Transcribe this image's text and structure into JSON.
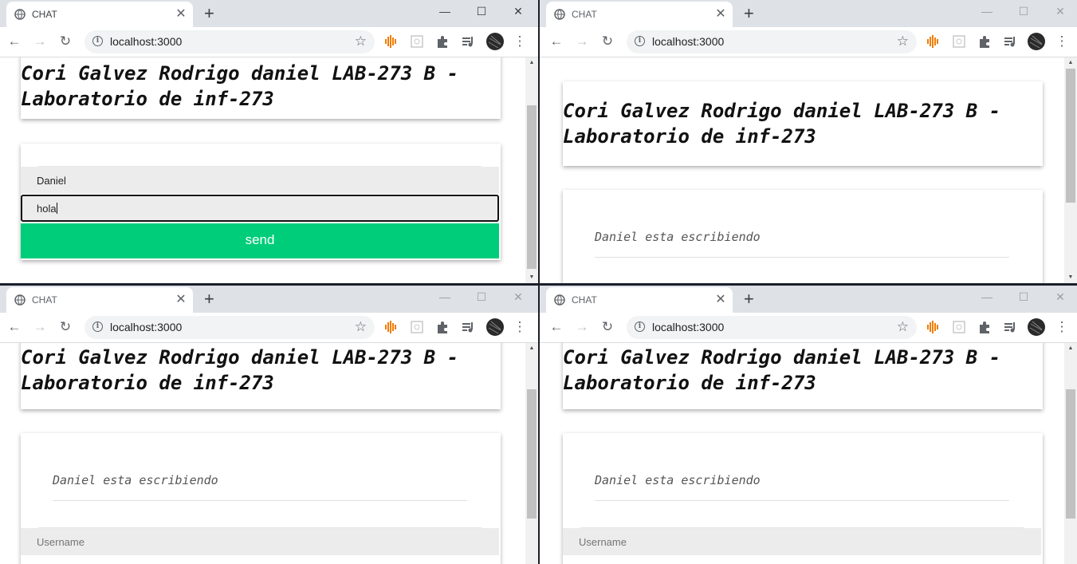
{
  "browser": {
    "tab_title": "CHAT",
    "tab_close": "✕",
    "new_tab": "+",
    "url": "localhost:3000",
    "minimize": "—",
    "maximize": "☐",
    "close": "✕",
    "back": "←",
    "forward": "→",
    "reload": "↻",
    "star": "☆",
    "menu": "⋮"
  },
  "page": {
    "title_line1": "Cori Galvez Rodrigo daniel LAB-273 B -",
    "title_line2": "Laboratorio de inf-273",
    "typing_message": "Daniel esta escribiendo",
    "username_placeholder": "Username",
    "username_value": "Daniel",
    "message_value": "hola",
    "send_label": "send"
  },
  "colors": {
    "send_button": "#00cd7a",
    "tabbar": "#dee1e6"
  }
}
